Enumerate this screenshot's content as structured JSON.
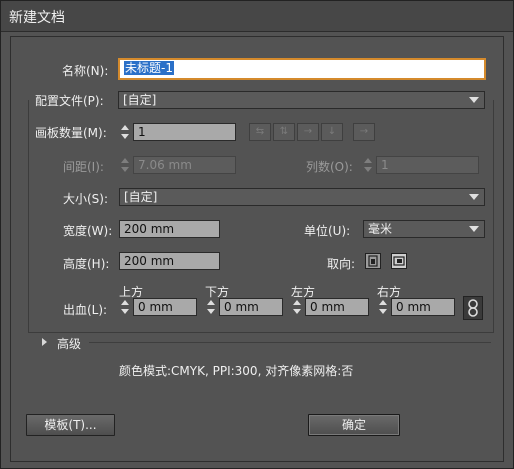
{
  "window": {
    "title": "新建文档"
  },
  "name": {
    "label": "名称(N):",
    "value": "未标题-1"
  },
  "profile": {
    "label": "配置文件(P):",
    "value": "[自定]"
  },
  "artboards": {
    "label": "画板数量(M):",
    "value": "1"
  },
  "spacing": {
    "label": "间距(I):",
    "value": "7.06 mm"
  },
  "columns": {
    "label": "列数(O):",
    "value": "1"
  },
  "size": {
    "label": "大小(S):",
    "value": "[自定]"
  },
  "width": {
    "label": "宽度(W):",
    "value": "200 mm"
  },
  "units": {
    "label": "单位(U):",
    "value": "毫米"
  },
  "height": {
    "label": "高度(H):",
    "value": "200 mm"
  },
  "orientation": {
    "label": "取向:"
  },
  "bleed": {
    "label": "出血(L):",
    "top": {
      "label": "上方",
      "value": "0 mm"
    },
    "bottom": {
      "label": "下方",
      "value": "0 mm"
    },
    "left": {
      "label": "左方",
      "value": "0 mm"
    },
    "right": {
      "label": "右方",
      "value": "0 mm"
    }
  },
  "advanced": {
    "label": "高级"
  },
  "info": "颜色模式:CMYK, PPI:300, 对齐像素网格:否",
  "buttons": {
    "templates": "模板(T)...",
    "ok": "确定"
  },
  "icons": [
    "spin-icon",
    "dropdown-arrow-icon",
    "grid-by-row-icon",
    "grid-by-column-icon",
    "arrange-by-row-icon",
    "arrange-by-column-icon",
    "right-to-left-icon",
    "portrait-icon",
    "landscape-icon",
    "link-icon",
    "disclosure-triangle-icon"
  ]
}
